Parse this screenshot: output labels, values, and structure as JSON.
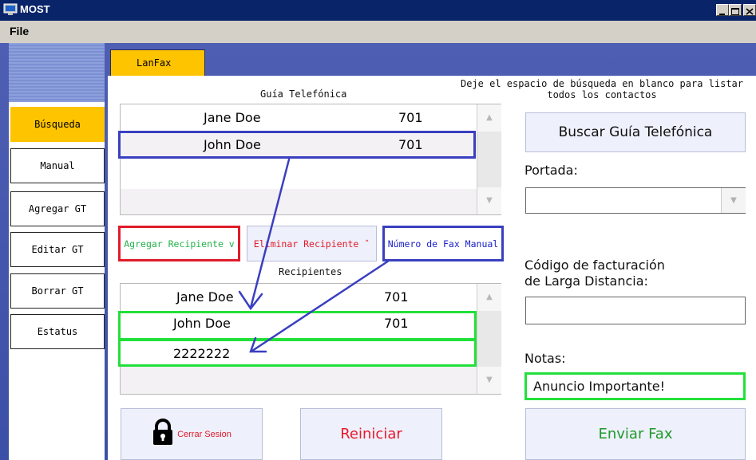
{
  "window": {
    "title": "MOST"
  },
  "menu": {
    "file": "File"
  },
  "tabs": {
    "lanfax": "LanFax"
  },
  "nav": {
    "busqueda": "Búsqueda",
    "manual": "Manual",
    "agregar_gt": "Agregar GT",
    "editar_gt": "Editar GT",
    "borrar_gt": "Borrar GT",
    "estatus": "Estatus"
  },
  "phonebook": {
    "title": "Guía Telefónica",
    "rows": [
      {
        "name": "Jane Doe",
        "value": "701"
      },
      {
        "name": "John Doe",
        "value": "701"
      }
    ]
  },
  "actions": {
    "add_recipient": "Agregar Recipiente v",
    "remove_recipient": "Eliminar Recipiente ˆ",
    "manual_fax": "Número de Fax Manual"
  },
  "recipients": {
    "title": "Recipientes",
    "rows": [
      {
        "name": "Jane Doe",
        "value": "701"
      },
      {
        "name": "John Doe",
        "value": "701"
      },
      {
        "name": "2222222",
        "value": ""
      }
    ]
  },
  "right": {
    "hint": "Deje el espacio de búsqueda en blanco para listar\ntodos los contactos",
    "search_button": "Buscar Guía Telefónica",
    "cover_label": "Portada:",
    "cover_value": "",
    "billing_label": "Código de facturación\nde Larga Distancia:",
    "billing_value": "",
    "notes_label": "Notas:",
    "notes_value": "Anuncio Importante!"
  },
  "buttons": {
    "logout": "Cerrar Sesion",
    "reset": "Reiniciar",
    "send_fax": "Enviar Fax"
  },
  "colors": {
    "highlight_blue": "#3a3fc0",
    "highlight_red": "#e01b2a",
    "highlight_green": "#22e03a",
    "tab_yellow": "#ffc400",
    "reset_text": "#e8192c",
    "send_text": "#1f9a2a"
  }
}
